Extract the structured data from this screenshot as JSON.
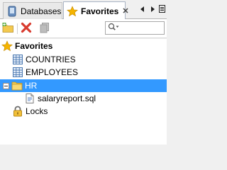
{
  "tabs": [
    {
      "label": "Databases",
      "icon": "database-icon",
      "active": false
    },
    {
      "label": "Favorites",
      "icon": "star-icon",
      "active": true
    }
  ],
  "toolbar": {
    "buttons": [
      {
        "icon": "new-folder-icon",
        "enabled": true
      },
      {
        "icon": "delete-icon",
        "enabled": true
      },
      {
        "icon": "copy-icon",
        "enabled": false
      }
    ],
    "search_value": ""
  },
  "tree": {
    "root": {
      "label": "Favorites",
      "icon": "star-icon"
    },
    "items": [
      {
        "label": "COUNTRIES",
        "icon": "table-icon",
        "selected": false
      },
      {
        "label": "EMPLOYEES",
        "icon": "table-icon",
        "selected": false
      },
      {
        "label": "HR",
        "icon": "folder-icon",
        "selected": true,
        "expanded": true
      },
      {
        "label": "salaryreport.sql",
        "icon": "sql-file-icon",
        "selected": false
      },
      {
        "label": "Locks",
        "icon": "lock-icon",
        "selected": false
      }
    ]
  },
  "colors": {
    "selection": "#3399ff",
    "accent_star": "#f5b400",
    "delete_red": "#d83a2e"
  }
}
